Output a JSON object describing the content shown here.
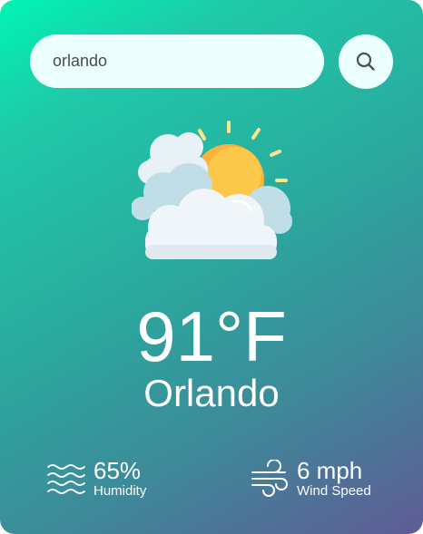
{
  "search": {
    "value": "orlando",
    "icon": "search-icon"
  },
  "weather": {
    "condition_icon": "partly-cloudy-icon",
    "temperature": "91°F",
    "city": "Orlando"
  },
  "stats": {
    "humidity": {
      "value": "65%",
      "label": "Humidity",
      "icon": "humidity-waves-icon"
    },
    "wind": {
      "value": "6 mph",
      "label": "Wind Speed",
      "icon": "wind-icon"
    }
  },
  "colors": {
    "gradient_start": "#00f5b4",
    "gradient_mid": "#2aa99e",
    "gradient_end": "#5f5b95",
    "input_bg": "#ebfffc",
    "text": "#ffffff"
  }
}
